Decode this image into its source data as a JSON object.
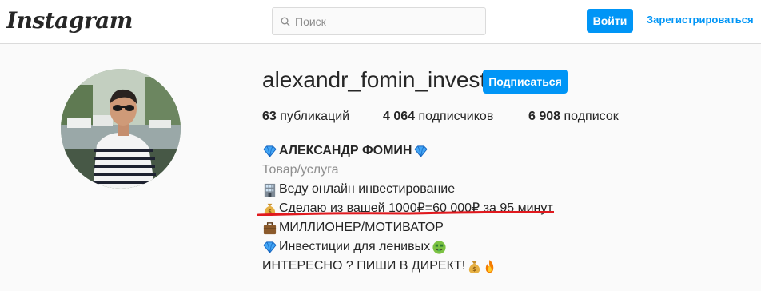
{
  "header": {
    "logo": "Instagram",
    "search_placeholder": "Поиск",
    "login_label": "Войти",
    "register_label": "Зарегистрироваться"
  },
  "profile": {
    "username": "alexandr_fomin_invest",
    "follow_label": "Подписаться",
    "stats": [
      {
        "count": "63",
        "label": " публикаций"
      },
      {
        "count": "4 064",
        "label": " подписчиков"
      },
      {
        "count": "6 908",
        "label": " подписок"
      }
    ],
    "bio": {
      "name": "АЛЕКСАНДР ФОМИН",
      "category": "Товар/услуга",
      "lines": [
        "Веду онлайн инвестирование",
        "Сделаю из вашей 1000₽=60 000₽ за 95 минут",
        "МИЛЛИОНЕР/МОТИВАТОР",
        "Инвестиции для ленивых",
        "ИНТЕРЕСНО ? ПИШИ В ДИРЕКТ!"
      ]
    }
  },
  "colors": {
    "accent": "#0095f6",
    "underline": "#e0191e"
  }
}
